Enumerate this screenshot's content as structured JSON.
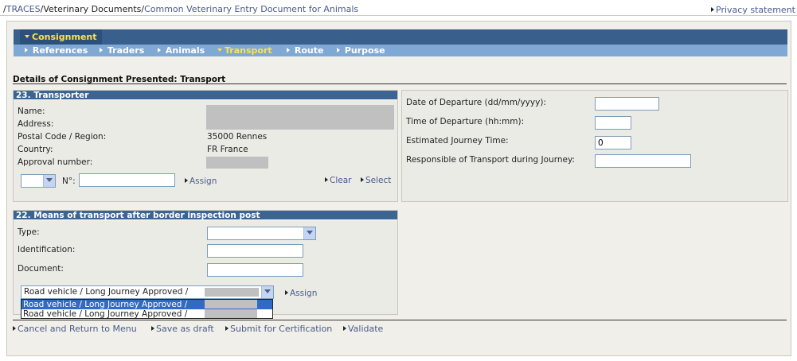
{
  "header": {
    "breadcrumb": [
      "/",
      "TRACES",
      "/",
      "Veterinary Documents",
      "/",
      "Common Veterinary Entry Document for Animals"
    ],
    "privacy_link": "Privacy statement"
  },
  "tabs": {
    "main": "Consignment",
    "sub": [
      "References",
      "Traders",
      "Animals",
      "Transport",
      "Route",
      "Purpose"
    ],
    "active_sub": "Transport"
  },
  "section_title": "Details of Consignment Presented: Transport",
  "transporter": {
    "title": "23. Transporter",
    "labels": {
      "name": "Name:",
      "address": "Address:",
      "postal": "Postal Code / Region:",
      "country": "Country:",
      "approval": "Approval number:"
    },
    "values": {
      "postal": "35000 Rennes",
      "country": "FR France"
    },
    "number_label": "N°:",
    "number_value": "",
    "assign_link": "Assign",
    "clear_link": "Clear",
    "select_link": "Select"
  },
  "departure": {
    "date_label": "Date of Departure (dd/mm/yyyy):",
    "date_value": "",
    "time_label": "Time of Departure (hh:mm):",
    "time_value": "",
    "journey_label": "Estimated Journey Time:",
    "journey_value": "0",
    "responsible_label": "Responsible of Transport during Journey:",
    "responsible_value": ""
  },
  "means_of_transport": {
    "title": "22. Means of transport after border inspection post",
    "type_label": "Type:",
    "type_value": "",
    "identification_label": "Identification:",
    "identification_value": "",
    "document_label": "Document:",
    "document_value": "",
    "vehicle_select_value": "Road vehicle / Long Journey Approved /",
    "vehicle_options": [
      "Road vehicle / Long Journey Approved /",
      "Road vehicle / Long Journey Approved /"
    ],
    "assign_link": "Assign"
  },
  "footer_links": [
    "Cancel and Return to Menu",
    "Save as draft",
    "Submit for Certification",
    "Validate"
  ],
  "colors": {
    "nav_dark": "#39608c",
    "nav_light": "#7fa8d4",
    "active_tab_text": "#ffe14d",
    "link": "#4a5b8c",
    "panel_header": "#3b6493"
  }
}
